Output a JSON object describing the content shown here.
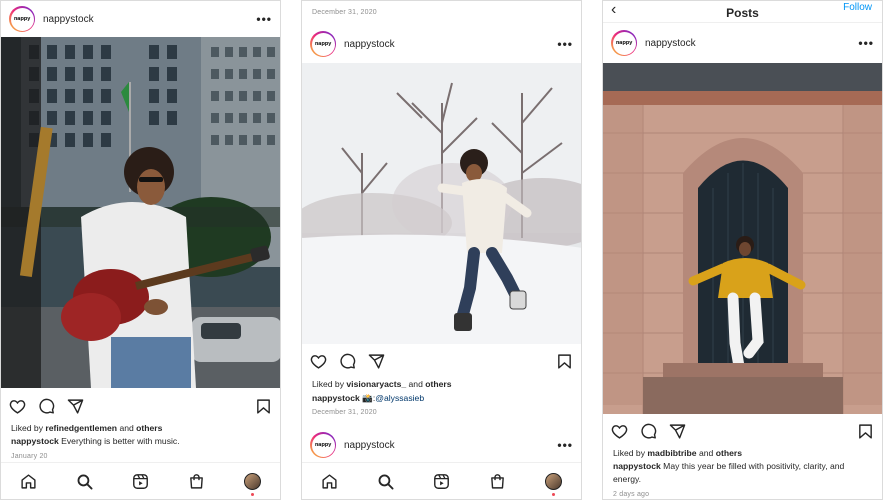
{
  "username": "nappystock",
  "avatar_text": "nappy",
  "more_glyph": "•••",
  "colors": {
    "link": "#00376b",
    "accent": "#0095f6",
    "notify": "#ed4956",
    "muted": "#8e8e8e"
  },
  "icons": [
    "heart-icon",
    "comment-icon",
    "share-icon",
    "bookmark-icon",
    "home-icon",
    "search-icon",
    "reels-icon",
    "shop-icon"
  ],
  "phone1": {
    "liked_by": "refinedgentlemen",
    "liked_and": "and",
    "liked_others": "others",
    "liked_prefix": "Liked by",
    "caption": "Everything is better with music.",
    "date": "January 20"
  },
  "phone2": {
    "top_date": "December 31, 2020",
    "liked_prefix": "Liked by",
    "liked_by": "visionaryacts_",
    "liked_and": "and",
    "liked_others": "others",
    "caption_emoji": "📸:",
    "caption_mention": "@alyssasieb",
    "date": "December 31, 2020"
  },
  "phone3": {
    "title": "Posts",
    "back_glyph": "‹",
    "follow": "Follow",
    "liked_prefix": "Liked by",
    "liked_by": "madbibtribe",
    "liked_and": "and",
    "liked_others": "others",
    "caption": "May this year be filled with positivity, clarity, and energy.",
    "date": "2 days ago"
  }
}
